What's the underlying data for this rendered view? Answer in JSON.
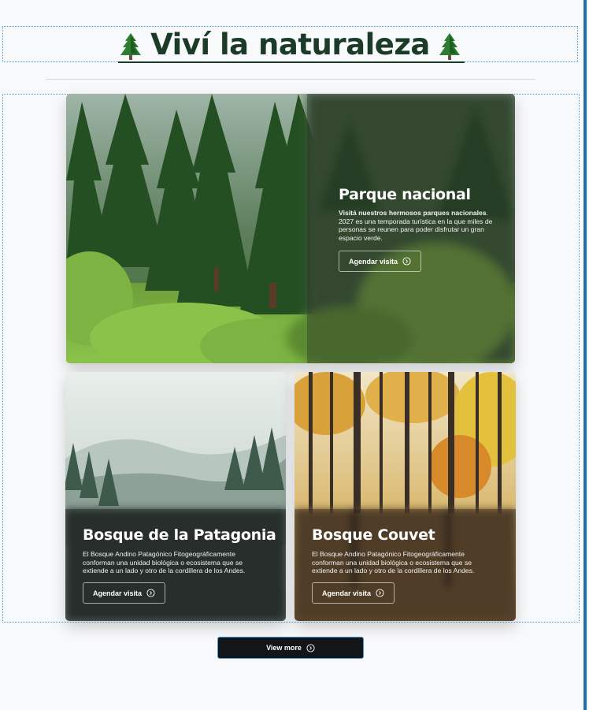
{
  "header": {
    "title": "Viví la naturaleza",
    "left_icon": "evergreen-tree-icon",
    "right_icon": "evergreen-tree-icon"
  },
  "cards": [
    {
      "title": "Parque nacional",
      "description_bold": "Visitá nuestros hermosos parques nacionales",
      "description": ". 2027 es una temporada turística en la que miles de personas se reunen para poder disfrutar un gran espacio verde.",
      "button_label": "Agendar visita",
      "button_icon": "arrow-circle-icon"
    },
    {
      "title": "Bosque de la Patagonia",
      "description": "El Bosque Andino Patagónico Fitogeográficamente conforman una unidad biológica o ecosistema que se extiende a un lado y otro de la cordillera de los Andes.",
      "button_label": "Agendar visita",
      "button_icon": "arrow-circle-icon"
    },
    {
      "title": "Bosque Couvet",
      "description": "El Bosque Andino Patagónico Fitogeográficamente conforman una unidad biológica o ecosistema que se extiende a un lado y otro de la cordillera de los Andes.",
      "button_label": "Agendar visita",
      "button_icon": "arrow-circle-icon"
    }
  ],
  "footer": {
    "view_more_label": "View more",
    "view_more_icon": "arrow-circle-icon"
  },
  "colors": {
    "title_green": "#1b3a27",
    "button_dark": "#131518",
    "outline_blue": "#4a9ad8"
  }
}
